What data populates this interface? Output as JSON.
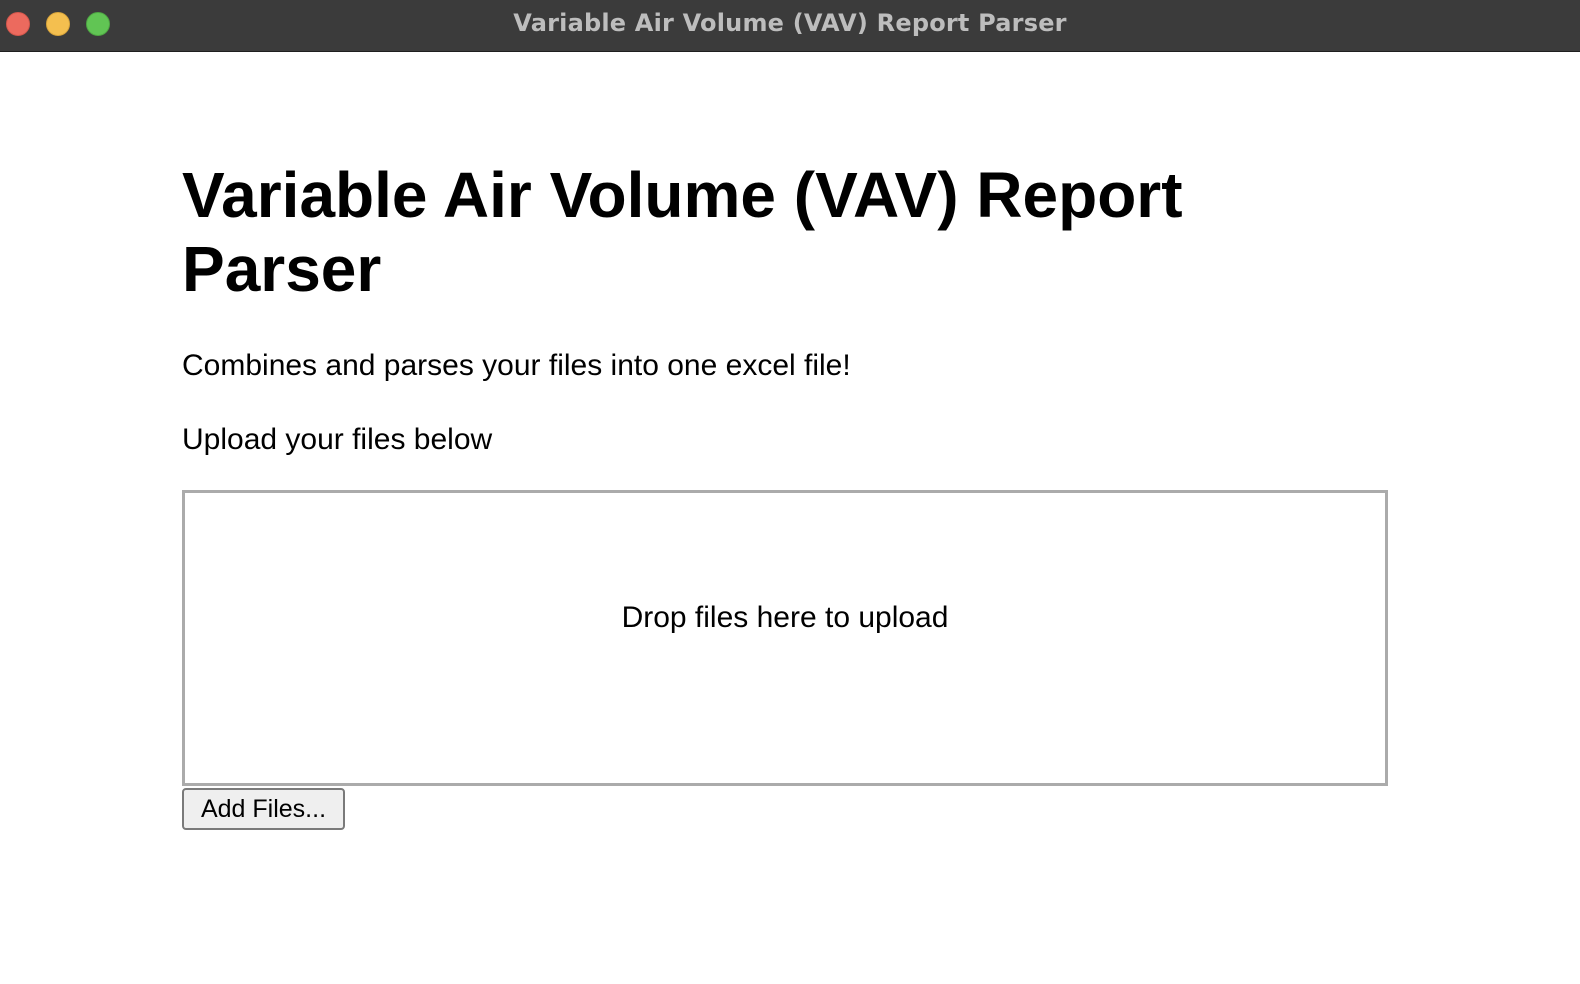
{
  "window": {
    "title": "Variable Air Volume (VAV) Report Parser",
    "controls": [
      "close",
      "minimize",
      "maximize"
    ]
  },
  "main": {
    "heading": "Variable Air Volume (VAV) Report Parser",
    "description": "Combines and parses your files into one excel file!",
    "upload_label": "Upload your files below",
    "dropzone_text": "Drop files here to upload",
    "add_files_label": "Add Files..."
  },
  "colors": {
    "titlebar": "#3b3b3b",
    "close": "#ec6a5e",
    "minimize": "#f4bf4f",
    "maximize": "#61c554",
    "dropzone_border": "#ababab"
  }
}
